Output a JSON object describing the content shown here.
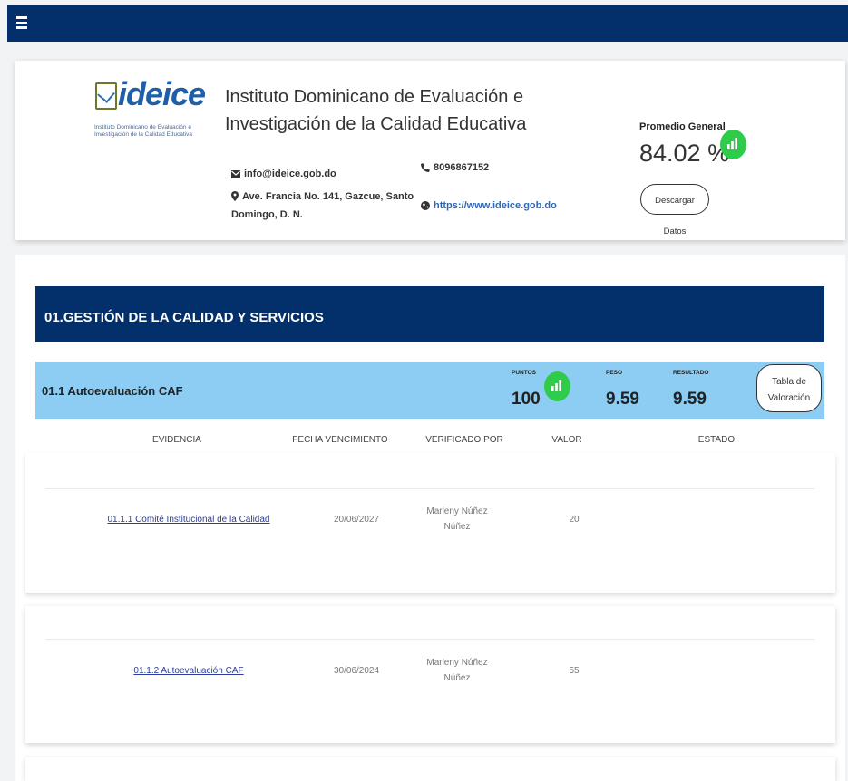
{
  "institution": {
    "logo_text": "ideice",
    "logo_subtext": "Instituto Dominicano de Evaluación e Investigación de la Calidad Educativa",
    "name": "Instituto Dominicano de Evaluación e Investigación de la Calidad Educativa",
    "email": "info@ideice.gob.do",
    "address": "Ave. Francia No. 141, Gazcue, Santo Domingo, D. N.",
    "phone": "8096867152",
    "website": "https://www.ideice.gob.do"
  },
  "summary": {
    "label": "Promedio General",
    "value": "84.02 %",
    "download_label": "Descargar Datos"
  },
  "section": {
    "title": "01.GESTIÓN DE LA CALIDAD Y SERVICIOS",
    "subsection": {
      "title": "01.1 Autoevaluación CAF",
      "puntos_label": "PUNTOS",
      "puntos_value": "100",
      "peso_label": "PESO",
      "peso_value": "9.59",
      "resultado_label": "RESULTADO",
      "resultado_value": "9.59",
      "tabla_label_1": "Tabla de",
      "tabla_label_2": "Valoración"
    },
    "columns": [
      "EVIDENCIA",
      "FECHA VENCIMIENTO",
      "VERIFICADO POR",
      "VALOR",
      "ESTADO"
    ],
    "rows": [
      {
        "evidencia": "01.1.1 Comité Institucional de la Calidad",
        "fecha": "20/06/2027",
        "verificado_1": "Marleny Núñez",
        "verificado_2": "Núñez",
        "valor": "20",
        "estado": ""
      },
      {
        "evidencia": "01.1.2 Autoevaluación CAF",
        "fecha": "30/06/2024",
        "verificado_1": "Marleny Núñez",
        "verificado_2": "Núñez",
        "valor": "55",
        "estado": ""
      }
    ]
  },
  "colors": {
    "navy": "#03306a",
    "light_blue": "#8dcdf3",
    "green": "#2ecc4a",
    "link": "#2b3c9a"
  },
  "icons": [
    "menu-icon",
    "envelope-icon",
    "map-marker-icon",
    "phone-icon",
    "globe-icon",
    "bar-chart-icon"
  ]
}
